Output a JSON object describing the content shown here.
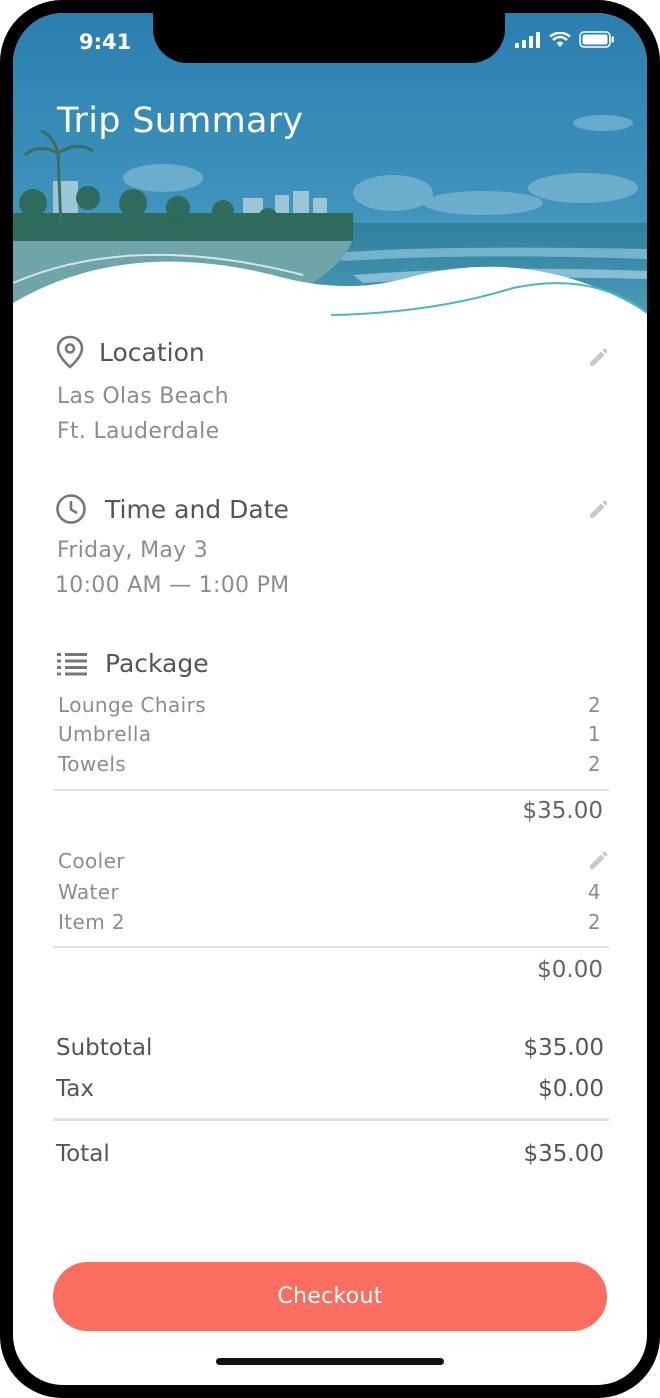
{
  "status_bar": {
    "time": "9:41"
  },
  "header": {
    "title": "Trip Summary"
  },
  "location": {
    "heading": "Location",
    "line1": "Las Olas Beach",
    "line2": "Ft. Lauderdale"
  },
  "time_date": {
    "heading": "Time and Date",
    "date": "Friday, May 3",
    "time": "10:00 AM — 1:00 PM"
  },
  "package": {
    "heading": "Package",
    "group1": {
      "items": [
        {
          "name": "Lounge Chairs",
          "qty": "2"
        },
        {
          "name": "Umbrella",
          "qty": "1"
        },
        {
          "name": "Towels",
          "qty": "2"
        }
      ],
      "price": "$35.00"
    },
    "group2": {
      "title": "Cooler",
      "items": [
        {
          "name": "Water",
          "qty": "4"
        },
        {
          "name": "Item 2",
          "qty": "2"
        }
      ],
      "price": "$0.00"
    }
  },
  "summary": {
    "subtotal_label": "Subtotal",
    "subtotal_value": "$35.00",
    "tax_label": "Tax",
    "tax_value": "$0.00",
    "total_label": "Total",
    "total_value": "$35.00"
  },
  "actions": {
    "checkout_label": "Checkout"
  },
  "colors": {
    "accent": "#fa6e60",
    "hero_tint": "#2a86b0"
  }
}
